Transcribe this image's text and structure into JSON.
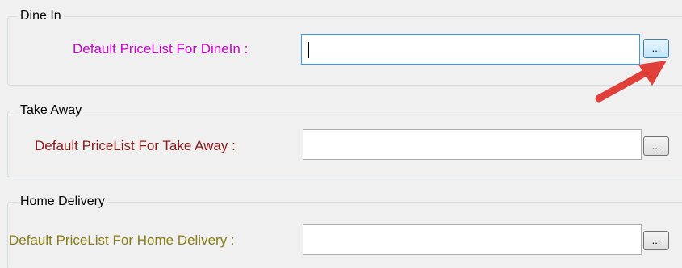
{
  "groups": [
    {
      "title": "Dine In",
      "label": "Default PriceList For DineIn :",
      "label_color": "#cc00cc",
      "value": "",
      "browse_label": "..."
    },
    {
      "title": "Take Away",
      "label": "Default PriceList For Take Away :",
      "label_color": "#8b1a1a",
      "value": "",
      "browse_label": "..."
    },
    {
      "title": "Home Delivery",
      "label": "Default PriceList For Home Delivery :",
      "label_color": "#8a7d12",
      "value": "",
      "browse_label": "..."
    }
  ],
  "annotation": {
    "icon": "red-arrow-icon",
    "color": "#e0403a"
  }
}
